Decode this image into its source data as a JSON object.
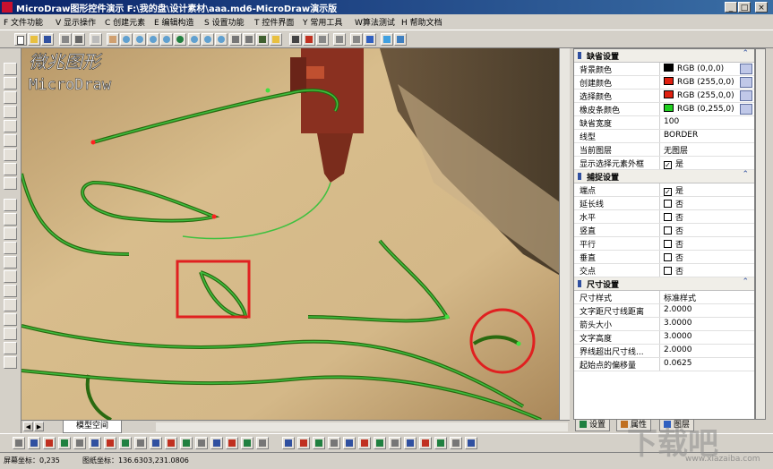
{
  "window": {
    "title": "MicroDraw图形控件演示  F:\\我的盘\\设计素材\\aaa.md6-MicroDraw演示版",
    "min": "_",
    "max": "□",
    "close": "×"
  },
  "menu": [
    "F 文件功能",
    "V 显示操作",
    "C 创建元素",
    "E 编辑构造",
    "S 设置功能",
    "T 控件界面",
    "Y 常用工具",
    "W算法测试",
    "H 帮助文档"
  ],
  "canvas": {
    "logo_cn": "微兆图形",
    "logo_en": "MicroDraw"
  },
  "model_tab": "模型空间",
  "panel": {
    "sections": [
      {
        "title": "缺省设置",
        "rows": [
          {
            "k": "背景颜色",
            "v": "RGB (0,0,0)",
            "swatch": "#000000"
          },
          {
            "k": "创建颜色",
            "v": "RGB (255,0,0)",
            "swatch": "#e02010"
          },
          {
            "k": "选择颜色",
            "v": "RGB (255,0,0)",
            "swatch": "#e02010"
          },
          {
            "k": "橡皮条颜色",
            "v": "RGB (0,255,0)",
            "swatch": "#20d020"
          },
          {
            "k": "缺省宽度",
            "v": "100"
          },
          {
            "k": "线型",
            "v": "BORDER"
          },
          {
            "k": "当前图层",
            "v": "无图层"
          },
          {
            "k": "显示选择元素外框",
            "v": "是",
            "check": true
          }
        ]
      },
      {
        "title": "捕捉设置",
        "rows": [
          {
            "k": "端点",
            "v": "是",
            "check": true
          },
          {
            "k": "延长线",
            "v": "否",
            "check": false
          },
          {
            "k": "水平",
            "v": "否",
            "check": false
          },
          {
            "k": "竖直",
            "v": "否",
            "check": false
          },
          {
            "k": "平行",
            "v": "否",
            "check": false
          },
          {
            "k": "垂直",
            "v": "否",
            "check": false
          },
          {
            "k": "交点",
            "v": "否",
            "check": false
          }
        ]
      },
      {
        "title": "尺寸设置",
        "rows": [
          {
            "k": "尺寸样式",
            "v": "标准样式"
          },
          {
            "k": "文字距尺寸线距离",
            "v": "2.0000"
          },
          {
            "k": "箭头大小",
            "v": "3.0000"
          },
          {
            "k": "文字高度",
            "v": "3.0000"
          },
          {
            "k": "界线超出尺寸线...",
            "v": "2.0000"
          },
          {
            "k": "起始点的偏移量",
            "v": "0.0625"
          }
        ]
      }
    ],
    "tabs": [
      "设置",
      "属性",
      "图层"
    ]
  },
  "status": {
    "screen": "屏幕坐标：0,235",
    "model": "图纸坐标：136.6303,231.0806"
  },
  "watermark": {
    "text": "下载吧",
    "url": "www.xiazaiba.com"
  }
}
